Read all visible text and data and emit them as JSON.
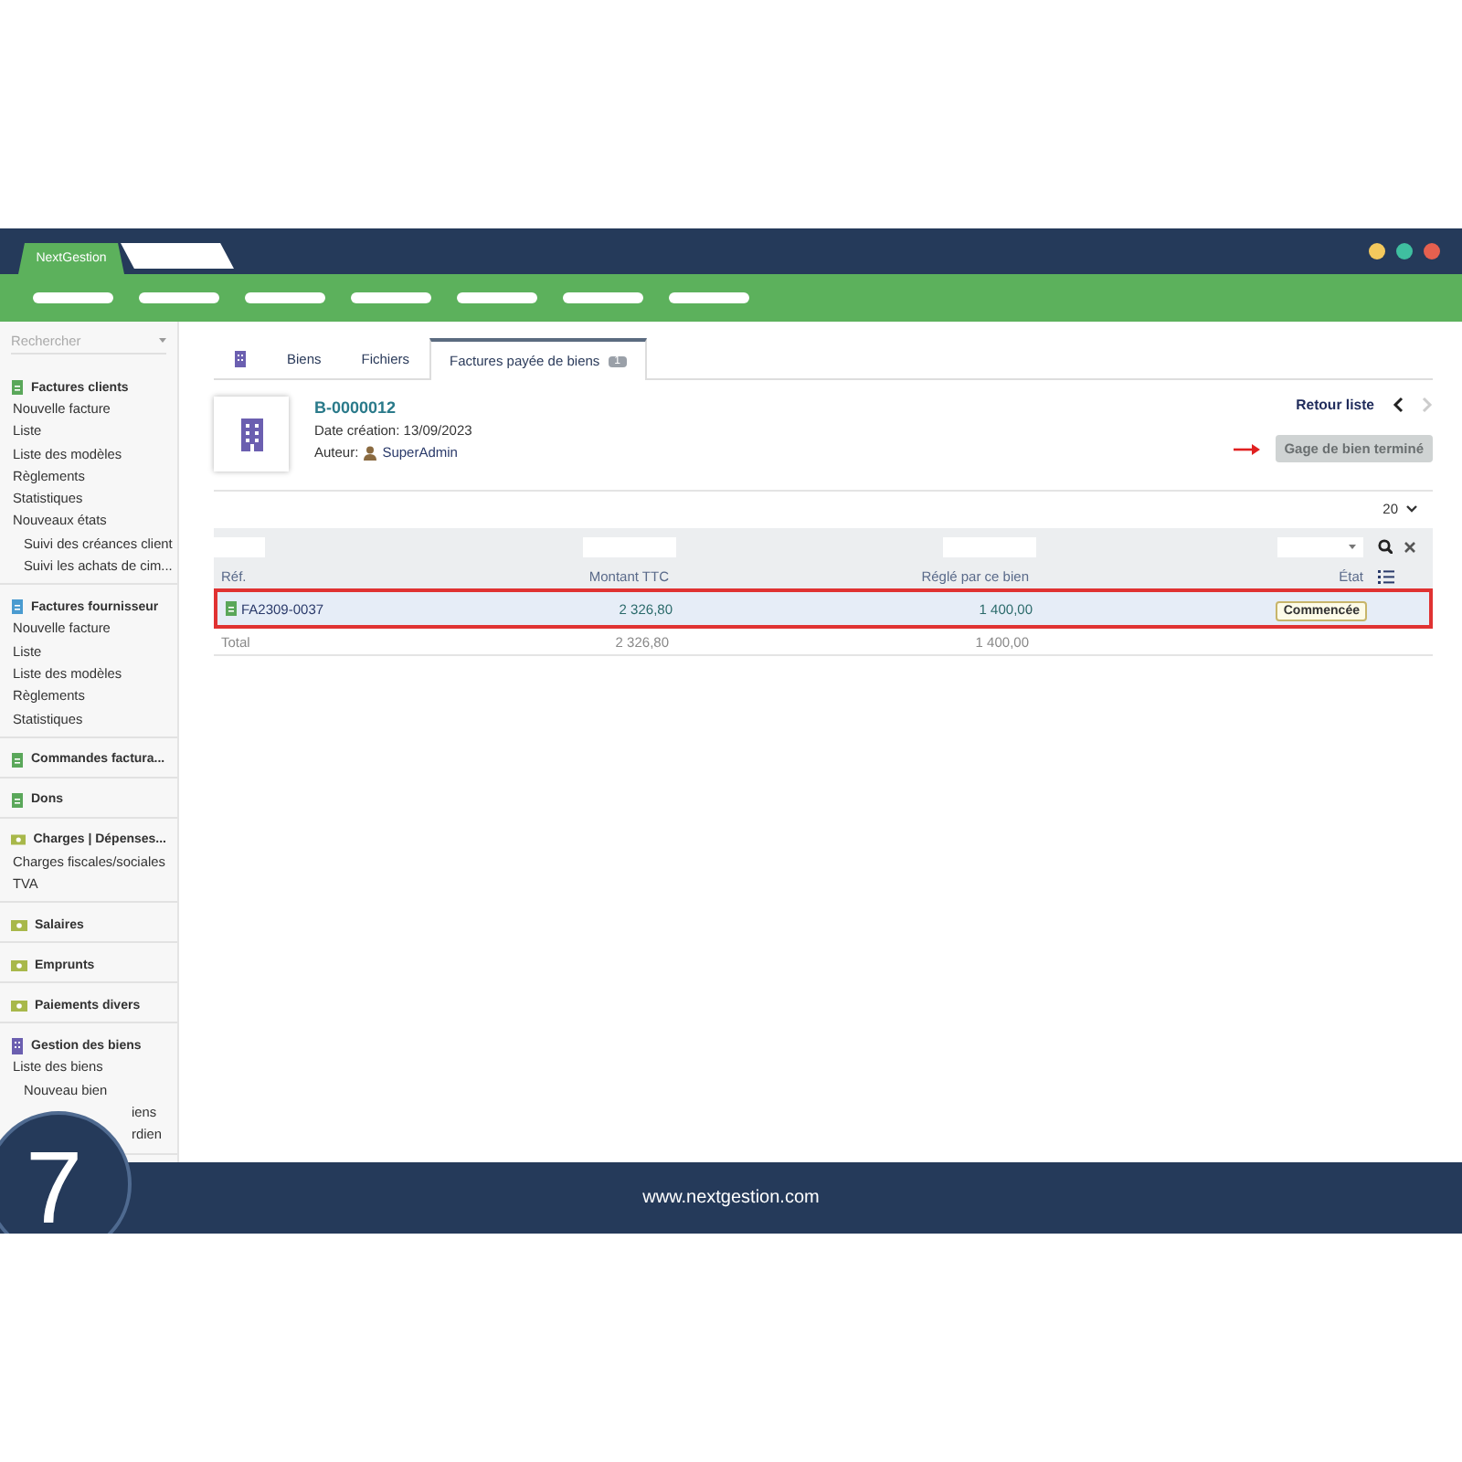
{
  "window": {
    "app_tab": "NextGestion",
    "footer_url": "www.nextgestion.com",
    "step_number": "7"
  },
  "sidebar": {
    "search_placeholder": "Rechercher",
    "sections": [
      {
        "title": "Factures clients",
        "kind": "doc",
        "color": "#5aa75a",
        "items": [
          {
            "label": "Nouvelle facture",
            "kind": "item"
          },
          {
            "label": "Liste",
            "kind": "item"
          },
          {
            "label": "Liste des modèles",
            "kind": "item"
          },
          {
            "label": "Règlements",
            "kind": "item"
          },
          {
            "label": "Statistiques",
            "kind": "item"
          },
          {
            "label": "Nouveaux états",
            "kind": "item"
          },
          {
            "label": "Suivi des créances client",
            "kind": "sub"
          },
          {
            "label": "Suivi les achats de cim...",
            "kind": "sub"
          }
        ]
      },
      {
        "title": "Factures fournisseur",
        "kind": "doc",
        "color": "#4a9bd0",
        "items": [
          {
            "label": "Nouvelle facture",
            "kind": "item"
          },
          {
            "label": "Liste",
            "kind": "item"
          },
          {
            "label": "Liste des modèles",
            "kind": "item"
          },
          {
            "label": "Règlements",
            "kind": "item"
          },
          {
            "label": "Statistiques",
            "kind": "item"
          }
        ]
      },
      {
        "title": "Commandes factura...",
        "kind": "doc",
        "color": "#5aa75a"
      },
      {
        "title": "Dons",
        "kind": "doc",
        "color": "#5aa75a"
      },
      {
        "title": "Charges | Dépenses...",
        "kind": "bill",
        "color": "#a8b84a",
        "items": [
          {
            "label": "Charges fiscales/sociales",
            "kind": "item"
          },
          {
            "label": "TVA",
            "kind": "item"
          }
        ]
      },
      {
        "title": "Salaires",
        "kind": "bill",
        "color": "#a8b84a"
      },
      {
        "title": "Emprunts",
        "kind": "bill",
        "color": "#a8b84a"
      },
      {
        "title": "Paiements divers",
        "kind": "bill",
        "color": "#a8b84a"
      },
      {
        "title": "Gestion des biens",
        "kind": "building",
        "color": "#6b5fb0",
        "items": [
          {
            "label": "Liste des biens",
            "kind": "item"
          },
          {
            "label": "Nouveau bien",
            "kind": "sub"
          },
          {
            "label": "iens",
            "kind": "clipped"
          },
          {
            "label": "rdien",
            "kind": "clipped"
          }
        ]
      }
    ]
  },
  "content": {
    "tabs": [
      {
        "kind": "icon",
        "selected": false
      },
      {
        "kind": "text",
        "label": "Biens",
        "selected": false
      },
      {
        "kind": "text",
        "label": "Fichiers",
        "selected": false
      },
      {
        "kind": "text",
        "label": "Factures payée de biens",
        "badge": "1",
        "selected": true
      }
    ],
    "record": {
      "ref": "B-0000012",
      "date": "Date création: 13/09/2023",
      "author_label": "Auteur:",
      "author": "SuperAdmin"
    },
    "nav": {
      "back": "Retour liste",
      "prev_disabled": false,
      "next_disabled": true
    },
    "action_button": {
      "label": "Gage de bien terminé",
      "disabled": true
    },
    "page_size": "20",
    "table": {
      "columns": [
        "Réf.",
        "Montant TTC",
        "Réglé par ce bien",
        "État"
      ],
      "rows": [
        {
          "ref": "FA2309-0037",
          "amount": "2 326,80",
          "paid": "1 400,00",
          "status": "Commencée",
          "selected": true
        }
      ],
      "total": {
        "label": "Total",
        "amount": "2 326,80",
        "paid": "1 400,00"
      }
    }
  }
}
